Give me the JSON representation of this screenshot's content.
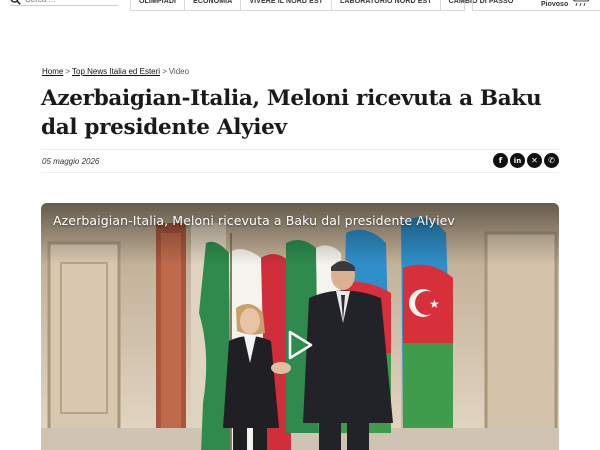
{
  "header": {
    "search": {
      "placeholder": "Cerca ..."
    },
    "nav": [
      "OLIMPIADI",
      "ECONOMIA",
      "VIVERE IL NORD EST",
      "LABORATORIO NORD EST",
      "CAMBIO DI PASSO"
    ],
    "weather": {
      "label": "Piovoso",
      "icon": "cloud-rain-icon"
    }
  },
  "breadcrumb": {
    "home": "Home",
    "separator": ">",
    "section": "Top News Italia ed Esteri",
    "current": "Video"
  },
  "article": {
    "title": "Azerbaigian-Italia, Meloni ricevuta a Baku dal presidente Alyiev",
    "date": "05 maggio 2026",
    "share": [
      {
        "icon": "facebook-icon",
        "glyph": "f"
      },
      {
        "icon": "linkedin-icon",
        "glyph": "in"
      },
      {
        "icon": "x-icon",
        "glyph": "✕"
      },
      {
        "icon": "whatsapp-icon",
        "glyph": "✆"
      }
    ]
  },
  "video": {
    "title": "Azerbaigian-Italia, Meloni ricevuta a Baku dal presidente Alyiev",
    "play_icon": "play-icon"
  },
  "colors": {
    "text": "#1a1a1a",
    "share_button": "#111111",
    "video_title": "#ffffff"
  }
}
